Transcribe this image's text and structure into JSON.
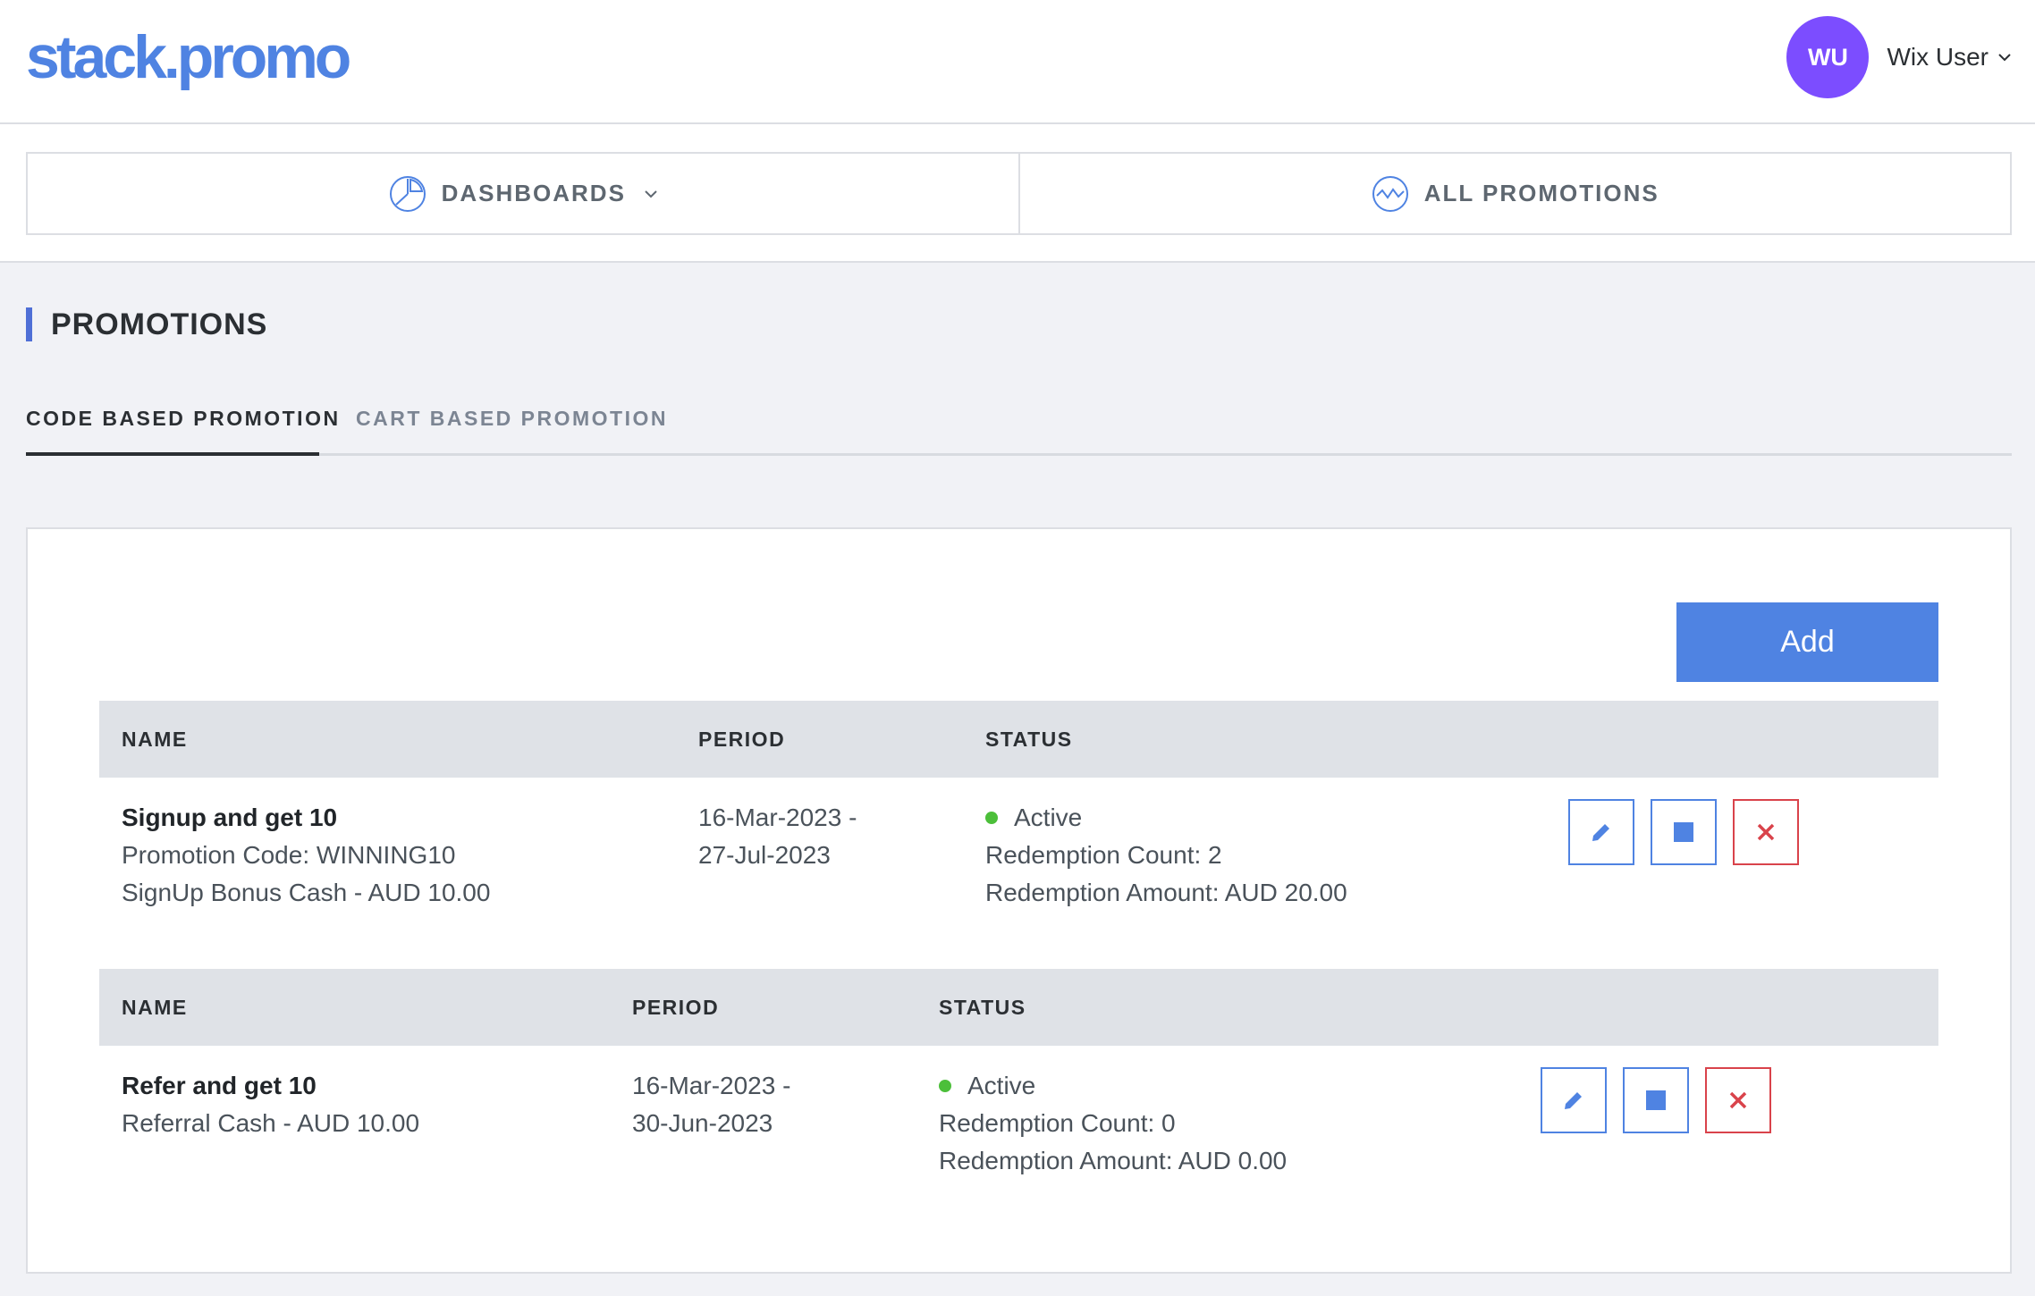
{
  "header": {
    "logo": "stack.promo",
    "avatar_initials": "WU",
    "user_name": "Wix User"
  },
  "nav": {
    "items": [
      {
        "label": "DASHBOARDS",
        "icon": "pie-chart-icon",
        "has_dropdown": true
      },
      {
        "label": "ALL PROMOTIONS",
        "icon": "wave-chart-icon",
        "has_dropdown": false
      }
    ]
  },
  "page": {
    "title": "PROMOTIONS",
    "tabs": [
      {
        "label": "CODE BASED PROMOTION",
        "active": true
      },
      {
        "label": "CART BASED PROMOTION",
        "active": false
      }
    ],
    "add_label": "Add"
  },
  "table_headers": {
    "name": "NAME",
    "period": "PERIOD",
    "status": "STATUS"
  },
  "promotions": [
    {
      "name": "Signup and get 10",
      "details": [
        "Promotion Code: WINNING10",
        "SignUp Bonus Cash - AUD 10.00"
      ],
      "period_start": "16-Mar-2023 -",
      "period_end": "27-Jul-2023",
      "status": "Active",
      "redemption_count": "Redemption Count: 2",
      "redemption_amount": "Redemption Amount: AUD 20.00"
    },
    {
      "name": "Refer and get 10",
      "details": [
        "Referral Cash - AUD 10.00"
      ],
      "period_start": "16-Mar-2023 -",
      "period_end": "30-Jun-2023",
      "status": "Active",
      "redemption_count": "Redemption Count: 0",
      "redemption_amount": "Redemption Amount: AUD 0.00"
    }
  ],
  "colors": {
    "brand": "#4f83e2",
    "avatar": "#7c4dff",
    "active_dot": "#4cbf3a",
    "delete": "#d9434b",
    "title_accent": "#4f6fd6"
  }
}
